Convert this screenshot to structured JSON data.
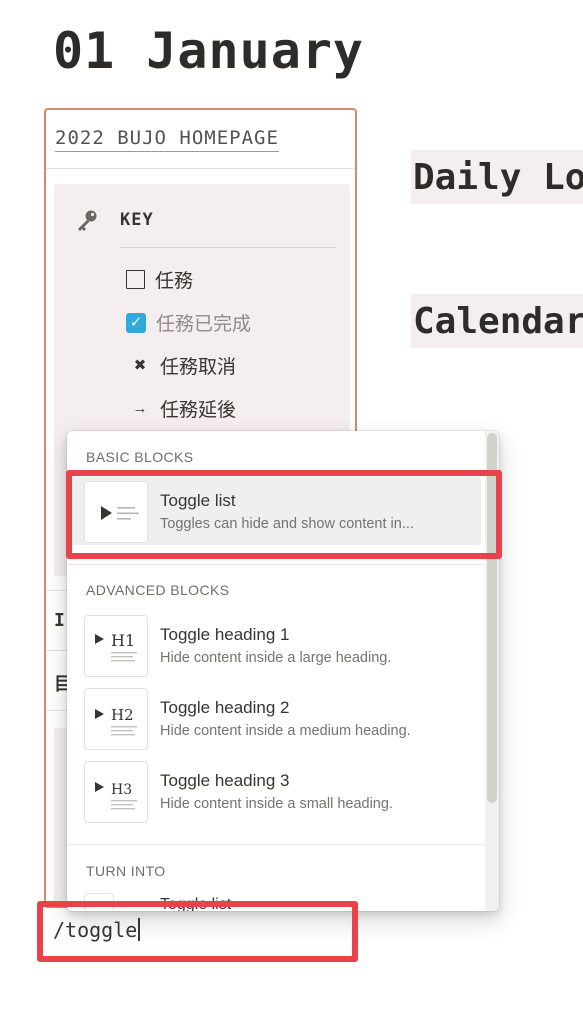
{
  "page": {
    "title": "01 January"
  },
  "sidebar": {
    "home_link": "2022 BUJO HOMEPAGE",
    "key_icon": "key-icon",
    "key_title": "KEY",
    "legend": [
      {
        "icon": "checkbox-empty-icon",
        "label": "任務"
      },
      {
        "icon": "checkbox-checked-icon",
        "label": "任務已完成",
        "check_glyph": "✓"
      },
      {
        "icon": "cross-icon",
        "glyph": "✖",
        "label": "任務取消"
      },
      {
        "icon": "arrow-right-icon",
        "glyph": "→",
        "label": "任務延後"
      }
    ],
    "row1_fragment": "I",
    "row2_fragment": "目"
  },
  "right_headings": [
    {
      "text": "Daily Log"
    },
    {
      "text": "Calendar"
    }
  ],
  "menu": {
    "basic_label": "BASIC BLOCKS",
    "advanced_label": "ADVANCED BLOCKS",
    "turn_into_label": "TURN INTO",
    "basic_items": [
      {
        "title": "Toggle list",
        "desc": "Toggles can hide and show content in...",
        "selected": true,
        "icon": "toggle-list-icon"
      }
    ],
    "advanced_items": [
      {
        "title": "Toggle heading 1",
        "desc": "Hide content inside a large heading.",
        "icon": "toggle-heading-1-icon",
        "badge": "H1"
      },
      {
        "title": "Toggle heading 2",
        "desc": "Hide content inside a medium heading.",
        "icon": "toggle-heading-2-icon",
        "badge": "H2"
      },
      {
        "title": "Toggle heading 3",
        "desc": "Hide content inside a small heading.",
        "icon": "toggle-heading-3-icon",
        "badge": "H3"
      }
    ],
    "turn_into_peek": "Toggle list"
  },
  "input": {
    "value": "/toggle"
  },
  "colors": {
    "highlight": "#e8434b",
    "card_border": "#d98873",
    "key_bg": "#f4eeee",
    "checkbox_blue": "#2eaadc",
    "selected_row": "#efefee"
  }
}
